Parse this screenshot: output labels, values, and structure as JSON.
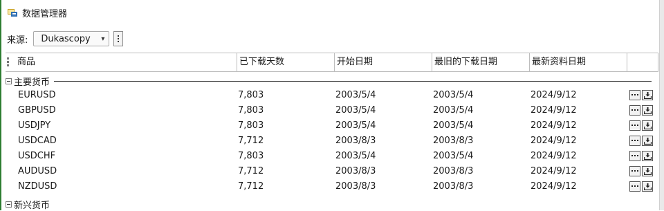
{
  "window": {
    "title": "数据管理器"
  },
  "source": {
    "label": "来源:",
    "selected": "Dukascopy"
  },
  "columns": [
    "商品",
    "已下载天数",
    "开始日期",
    "最旧的下载日期",
    "最新资料日期"
  ],
  "groups": [
    {
      "label": "主要货币",
      "rows": [
        {
          "symbol": "EURUSD",
          "days": "7,803",
          "start": "2003/5/4",
          "oldest": "2003/5/4",
          "latest": "2024/9/12"
        },
        {
          "symbol": "GBPUSD",
          "days": "7,803",
          "start": "2003/5/4",
          "oldest": "2003/5/4",
          "latest": "2024/9/12"
        },
        {
          "symbol": "USDJPY",
          "days": "7,803",
          "start": "2003/5/4",
          "oldest": "2003/5/4",
          "latest": "2024/9/12"
        },
        {
          "symbol": "USDCAD",
          "days": "7,712",
          "start": "2003/8/3",
          "oldest": "2003/8/3",
          "latest": "2024/9/12"
        },
        {
          "symbol": "USDCHF",
          "days": "7,803",
          "start": "2003/5/4",
          "oldest": "2003/5/4",
          "latest": "2024/9/12"
        },
        {
          "symbol": "AUDUSD",
          "days": "7,712",
          "start": "2003/8/3",
          "oldest": "2003/8/3",
          "latest": "2024/9/12"
        },
        {
          "symbol": "NZDUSD",
          "days": "7,712",
          "start": "2003/8/3",
          "oldest": "2003/8/3",
          "latest": "2024/9/12"
        }
      ]
    },
    {
      "label": "新兴货币"
    }
  ],
  "icons": {
    "more": "more-icon",
    "download": "download-icon"
  }
}
